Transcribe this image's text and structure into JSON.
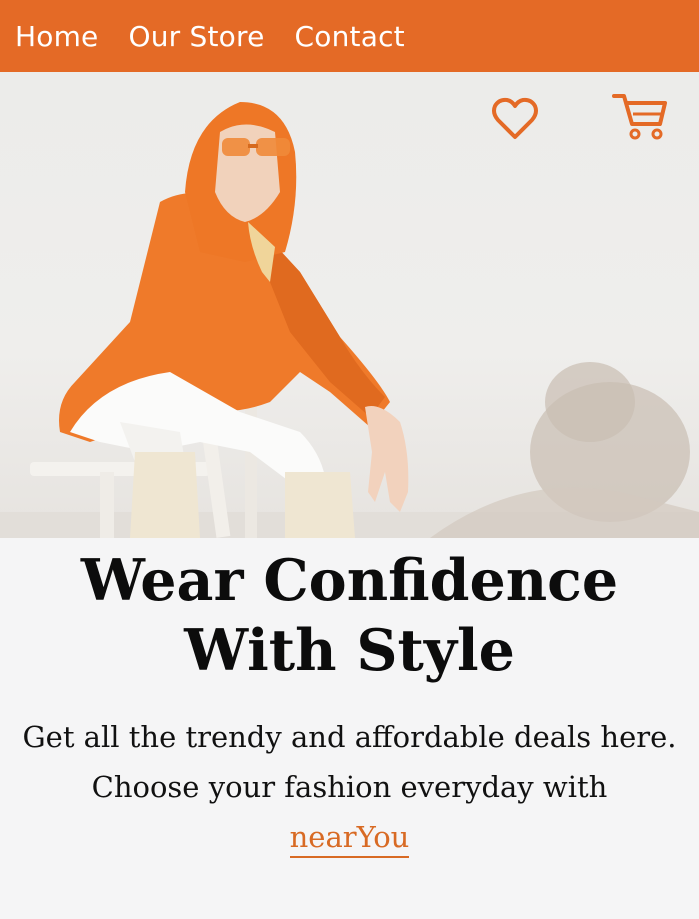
{
  "nav": {
    "links": [
      "Home",
      "Our Store",
      "Contact"
    ]
  },
  "hero": {
    "icons": [
      "heart-icon",
      "cart-icon"
    ]
  },
  "headline": {
    "line1": "Wear Confidence",
    "line2": "With Style"
  },
  "tagline": {
    "line1": "Get all the trendy and affordable deals here.",
    "line2": "Choose your fashion everyday with",
    "brand": "nearYou"
  },
  "colors": {
    "accent": "#e46a26",
    "background": "#f5f5f6",
    "text": "#0c0c0c"
  }
}
